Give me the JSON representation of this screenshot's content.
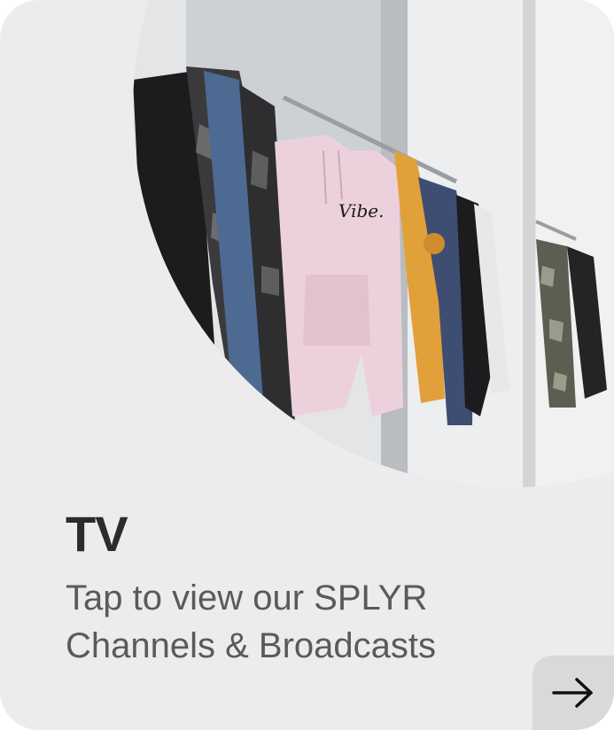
{
  "card": {
    "title": "TV",
    "subtitle_lines": [
      "Tap to view our SPLYR",
      "Channels & Broadcasts"
    ],
    "image_alt_icon": "clothing-rack-photo",
    "action_icon": "arrow-right-icon"
  },
  "colors": {
    "card_background": "#ececec",
    "title": "#2b2b2b",
    "subtitle": "#5a5a5a",
    "action_button": "#d9d9d9"
  }
}
